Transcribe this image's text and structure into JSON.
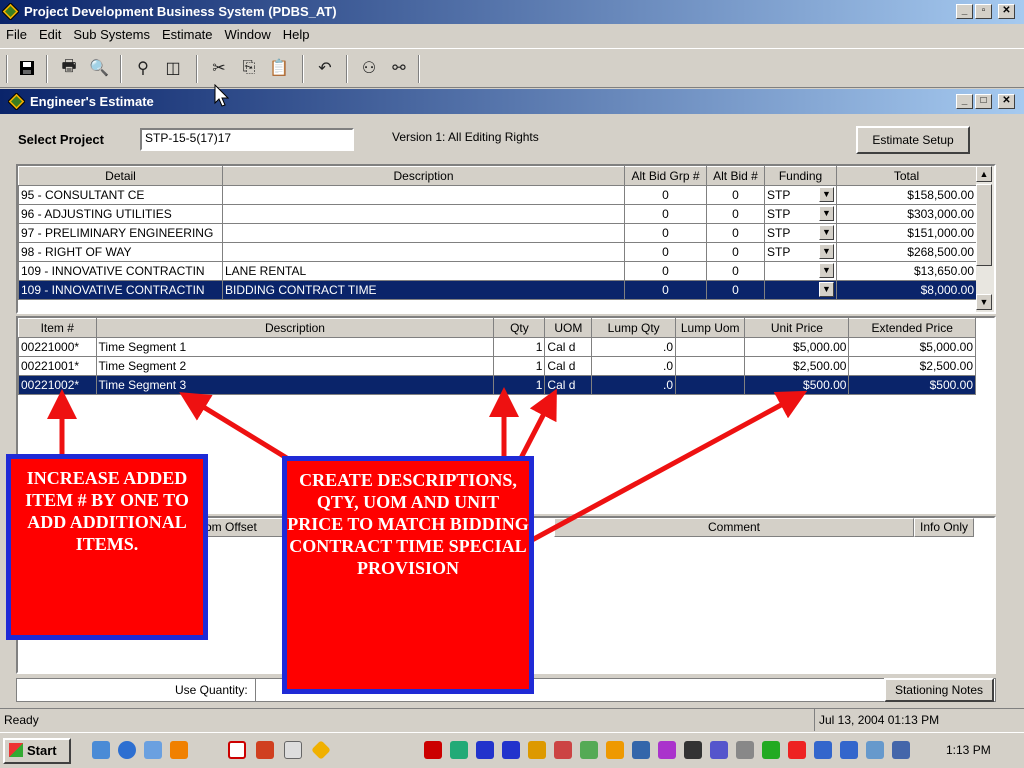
{
  "app": {
    "title": "Project Development Business System (PDBS_AT)"
  },
  "menu": [
    "File",
    "Edit",
    "Sub Systems",
    "Estimate",
    "Window",
    "Help"
  ],
  "toolbar": {
    "icons": [
      "save-icon",
      "print-icon",
      "print-preview-icon",
      "find-icon",
      "panel-icon",
      "cut-icon",
      "copy-icon",
      "paste-icon",
      "undo-icon",
      "binoculars-icon",
      "find-replace-icon"
    ]
  },
  "child_window": {
    "title": "Engineer's Estimate"
  },
  "project": {
    "select_label": "Select Project",
    "value": "STP-15-5(17)17",
    "version": "Version 1: All Editing Rights",
    "setup_button": "Estimate Setup"
  },
  "upper_grid": {
    "headers": [
      "Detail",
      "Description",
      "Alt Bid Grp #",
      "Alt Bid #",
      "Funding",
      "Total"
    ],
    "rows": [
      {
        "detail": "95 - CONSULTANT CE",
        "desc": "",
        "grp": "0",
        "alt": "0",
        "fund": "STP",
        "total": "$158,500.00"
      },
      {
        "detail": "96 - ADJUSTING UTILITIES",
        "desc": "",
        "grp": "0",
        "alt": "0",
        "fund": "STP",
        "total": "$303,000.00"
      },
      {
        "detail": "97 - PRELIMINARY ENGINEERING",
        "desc": "",
        "grp": "0",
        "alt": "0",
        "fund": "STP",
        "total": "$151,000.00"
      },
      {
        "detail": "98 - RIGHT OF WAY",
        "desc": "",
        "grp": "0",
        "alt": "0",
        "fund": "STP",
        "total": "$268,500.00"
      },
      {
        "detail": "109 - INNOVATIVE CONTRACTIN",
        "desc": "LANE RENTAL",
        "grp": "0",
        "alt": "0",
        "fund": "",
        "total": "$13,650.00"
      },
      {
        "detail": "109 - INNOVATIVE CONTRACTIN",
        "desc": "BIDDING CONTRACT TIME",
        "grp": "0",
        "alt": "0",
        "fund": "",
        "total": "$8,000.00",
        "selected": true
      }
    ]
  },
  "lower_grid": {
    "headers": [
      "Item #",
      "Description",
      "Qty",
      "UOM",
      "Lump Qty",
      "Lump Uom",
      "Unit Price",
      "Extended Price"
    ],
    "rows": [
      {
        "item": "00221000*",
        "desc": "Time Segment 1",
        "qty": "1",
        "uom": "Cal d",
        "lqty": ".0",
        "luom": "",
        "unit": "$5,000.00",
        "ext": "$5,000.00"
      },
      {
        "item": "00221001*",
        "desc": "Time Segment 2",
        "qty": "1",
        "uom": "Cal d",
        "lqty": ".0",
        "luom": "",
        "unit": "$2,500.00",
        "ext": "$2,500.00"
      },
      {
        "item": "00221002*",
        "desc": "Time Segment 3",
        "qty": "1",
        "uom": "Cal d",
        "lqty": ".0",
        "luom": "",
        "unit": "$500.00",
        "ext": "$500.00",
        "selected": true
      }
    ]
  },
  "bottom_grid": {
    "headers": [
      "rom Offset",
      "Comment",
      "Info Only"
    ]
  },
  "use_quantity_label": "Use Quantity:",
  "stationing_button": "Stationing Notes",
  "callouts": {
    "left": "INCREASE ADDED ITEM # BY ONE TO ADD ADDITIONAL ITEMS.",
    "center": "CREATE DESCRIPTIONS, QTY, UOM AND UNIT PRICE TO MATCH BIDDING CONTRACT TIME SPECIAL PROVISION"
  },
  "status": {
    "text": "Ready",
    "datetime": "Jul 13, 2004 01:13 PM"
  },
  "taskbar": {
    "start": "Start",
    "clock": "1:13 PM"
  },
  "colors": {
    "title_start": "#0a246a",
    "title_end": "#a6caf0",
    "callout_fill": "#ff0000",
    "callout_border": "#1f2ad6",
    "arrow": "#ee1111"
  }
}
